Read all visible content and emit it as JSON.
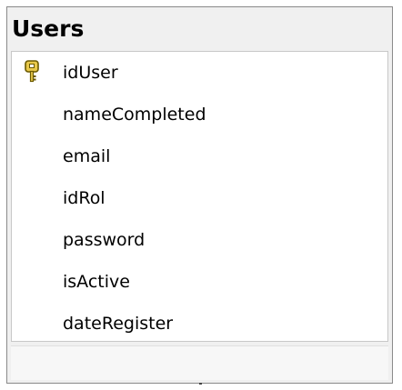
{
  "table": {
    "title": "Users",
    "columns": [
      {
        "label": "idUser",
        "primary_key": true
      },
      {
        "label": "nameCompleted",
        "primary_key": false
      },
      {
        "label": "email",
        "primary_key": false
      },
      {
        "label": "idRol",
        "primary_key": false
      },
      {
        "label": "password",
        "primary_key": false
      },
      {
        "label": "isActive",
        "primary_key": false
      },
      {
        "label": "dateRegister",
        "primary_key": false
      }
    ]
  },
  "colors": {
    "border": "#8a8a8a",
    "background": "#f0f0f0",
    "key_fill": "#e8c84a"
  },
  "icons": {
    "primary_key": "key-icon"
  }
}
